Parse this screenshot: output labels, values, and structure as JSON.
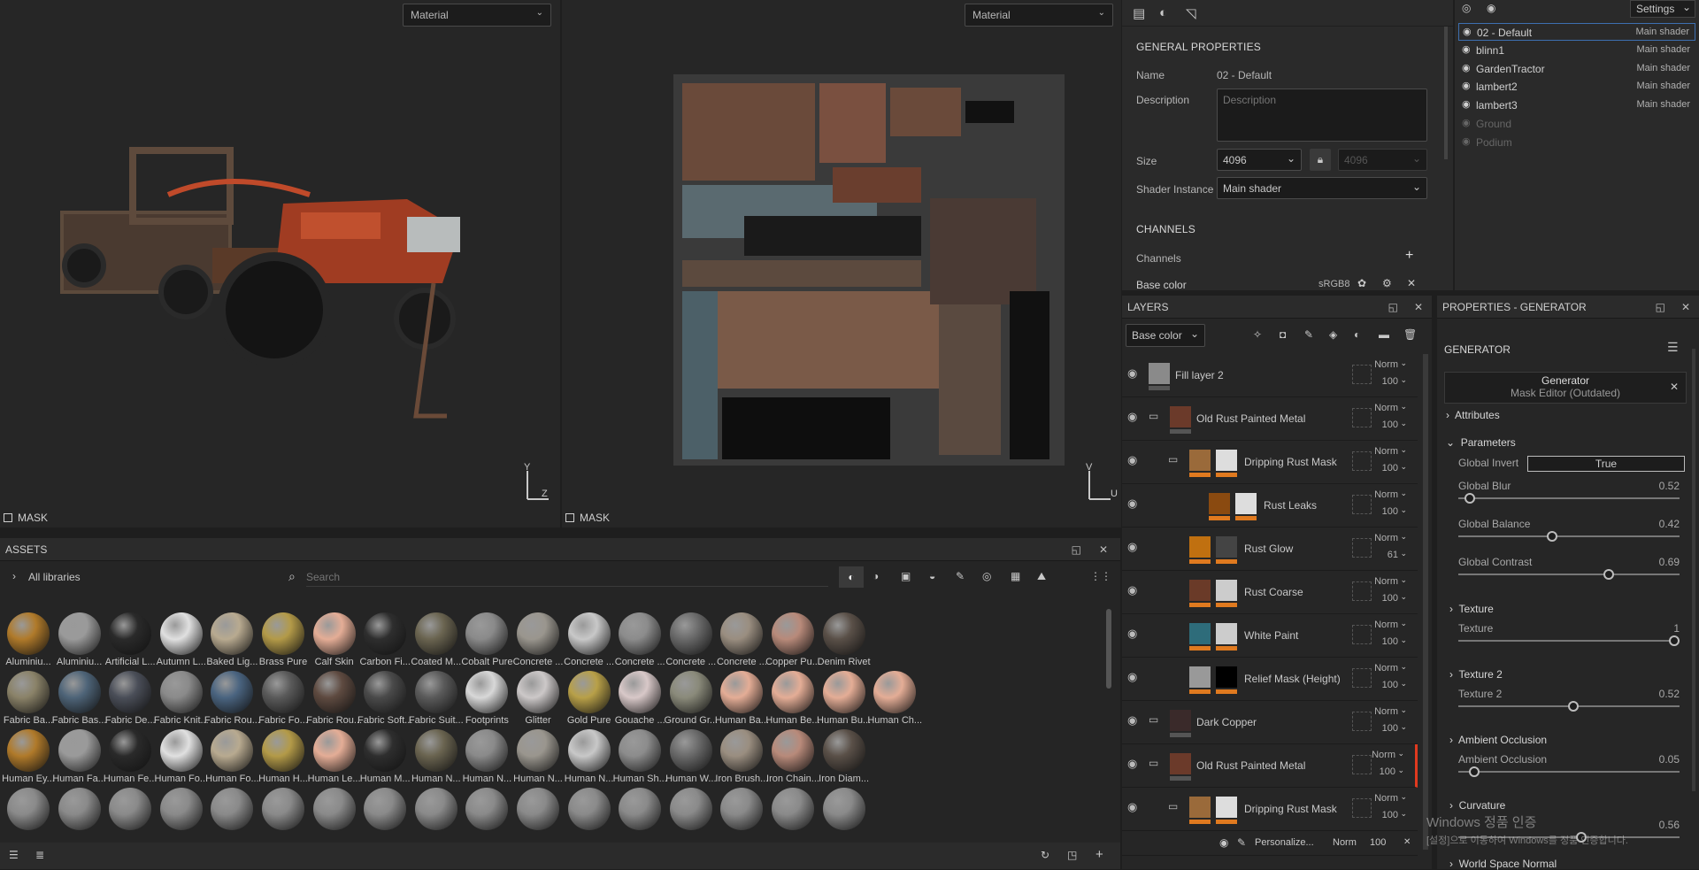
{
  "viewport3d": {
    "dropdown": "Material",
    "mask_label": "MASK"
  },
  "viewport2d": {
    "dropdown": "Material",
    "mask_label": "MASK"
  },
  "axis": {
    "y": "Y",
    "z": "Z",
    "v": "V",
    "u": "U"
  },
  "assets": {
    "title": "ASSETS",
    "library": "All libraries",
    "search_placeholder": "Search",
    "rows": [
      [
        "Aluminiu...",
        "Aluminiu...",
        "Artificial L...",
        "Autumn L...",
        "Baked Lig...",
        "Brass Pure",
        "Calf Skin",
        "Carbon Fi...",
        "Coated M...",
        "Cobalt Pure",
        "Concrete ...",
        "Concrete ...",
        "Concrete ...",
        "Concrete ...",
        "Concrete ...",
        "Copper Pu...",
        "Denim Rivet"
      ],
      [
        "Fabric Ba...",
        "Fabric Bas...",
        "Fabric De...",
        "Fabric Knit...",
        "Fabric Rou...",
        "Fabric Fo...",
        "Fabric Rou...",
        "Fabric Soft...",
        "Fabric Suit...",
        "Footprints",
        "Glitter",
        "Gold Pure",
        "Gouache ...",
        "Ground Gr...",
        "Human Ba...",
        "Human Be...",
        "Human Bu...",
        "Human Ch..."
      ],
      [
        "Human Ey...",
        "Human Fa...",
        "Human Fe...",
        "Human Fo...",
        "Human Fo...",
        "Human H...",
        "Human Le...",
        "Human M...",
        "Human N...",
        "Human N...",
        "Human N...",
        "Human N...",
        "Human Sh...",
        "Human W...",
        "Iron Brush...",
        "Iron Chain...",
        "Iron Diam..."
      ]
    ]
  },
  "properties_top": {
    "general_title": "GENERAL PROPERTIES",
    "name_label": "Name",
    "name_value": "02 - Default",
    "description_label": "Description",
    "description_placeholder": "Description",
    "size_label": "Size",
    "size_value": "4096",
    "size_value2": "4096",
    "shader_label": "Shader Instance",
    "shader_value": "Main shader",
    "channels_title": "CHANNELS",
    "channels_label": "Channels",
    "base_color_label": "Base color",
    "base_color_space": "sRGB8"
  },
  "texture_sets": {
    "settings": "Settings",
    "items": [
      {
        "name": "02 - Default",
        "shader": "Main shader",
        "active": true,
        "enabled": true
      },
      {
        "name": "blinn1",
        "shader": "Main shader",
        "active": false,
        "enabled": true
      },
      {
        "name": "GardenTractor",
        "shader": "Main shader",
        "active": false,
        "enabled": true
      },
      {
        "name": "lambert2",
        "shader": "Main shader",
        "active": false,
        "enabled": true
      },
      {
        "name": "lambert3",
        "shader": "Main shader",
        "active": false,
        "enabled": true
      },
      {
        "name": "Ground",
        "shader": "",
        "active": false,
        "enabled": false
      },
      {
        "name": "Podium",
        "shader": "",
        "active": false,
        "enabled": false
      }
    ]
  },
  "layers": {
    "title": "LAYERS",
    "channel": "Base color",
    "items": [
      {
        "name": "Fill layer 2",
        "blend": "Norm",
        "opacity": "100",
        "indent": 0,
        "folder": false,
        "thumb": "#8a8a8a",
        "mask": null
      },
      {
        "name": "Old Rust Painted Metal",
        "blend": "Norm",
        "opacity": "100",
        "indent": 0,
        "folder": true,
        "thumb": "#6b3a2a",
        "mask": null
      },
      {
        "name": "Dripping Rust Mask",
        "blend": "Norm",
        "opacity": "100",
        "indent": 1,
        "folder": true,
        "thumb": "#9a6a3a",
        "mask": "#ddd"
      },
      {
        "name": "Rust Leaks",
        "blend": "Norm",
        "opacity": "100",
        "indent": 2,
        "folder": false,
        "thumb": "#8a4a10",
        "mask": "#ddd"
      },
      {
        "name": "Rust Glow",
        "blend": "Norm",
        "opacity": "61",
        "indent": 1,
        "folder": false,
        "thumb": "#c07010",
        "mask": "#444"
      },
      {
        "name": "Rust Coarse",
        "blend": "Norm",
        "opacity": "100",
        "indent": 1,
        "folder": false,
        "thumb": "#6a3a28",
        "mask": "#ccc"
      },
      {
        "name": "White Paint",
        "blend": "Norm",
        "opacity": "100",
        "indent": 1,
        "folder": false,
        "thumb": "#2e6c7a",
        "mask": "#ccc"
      },
      {
        "name": "Relief Mask (Height)",
        "blend": "Norm",
        "opacity": "100",
        "indent": 1,
        "folder": false,
        "thumb": "#999",
        "mask": "#000"
      },
      {
        "name": "Dark Copper",
        "blend": "Norm",
        "opacity": "100",
        "indent": 0,
        "folder": true,
        "thumb": "#3a2a2a",
        "mask": null
      },
      {
        "name": "Old Rust Painted Metal",
        "blend": "Norm",
        "opacity": "100",
        "indent": 0,
        "folder": true,
        "thumb": "#6b3a2a",
        "mask": null
      },
      {
        "name": "Dripping Rust Mask",
        "blend": "Norm",
        "opacity": "100",
        "indent": 1,
        "folder": true,
        "thumb": "#9a6a3a",
        "mask": "#ddd"
      }
    ],
    "sub_row": {
      "name": "Personalize...",
      "blend": "Norm",
      "opacity": "100"
    }
  },
  "generator": {
    "title": "PROPERTIES - GENERATOR",
    "section": "GENERATOR",
    "card_title": "Generator",
    "card_subtitle": "Mask Editor (Outdated)",
    "attributes": "Attributes",
    "parameters": "Parameters",
    "global_invert_label": "Global Invert",
    "global_invert_value": "True",
    "params": [
      {
        "label": "Global Blur",
        "value": "0.52",
        "fraction": 0.03
      },
      {
        "label": "Global Balance",
        "value": "0.42",
        "fraction": 0.42
      },
      {
        "label": "Global Contrast",
        "value": "0.69",
        "fraction": 0.69
      }
    ],
    "groups": [
      {
        "title": "Texture",
        "label": "Texture",
        "value": "1",
        "fraction": 1.0
      },
      {
        "title": "Texture 2",
        "label": "Texture 2",
        "value": "0.52",
        "fraction": 0.52
      },
      {
        "title": "Ambient Occlusion",
        "label": "Ambient Occlusion",
        "value": "0.05",
        "fraction": 0.05
      },
      {
        "title": "Curvature",
        "label": "",
        "value": "0.56",
        "fraction": 0.56
      }
    ],
    "world_space_normal": "World Space Normal"
  },
  "watermark": {
    "line1": "Windows 정품 인증",
    "line2": "[설정]으로 이동하여 Windows를 정품 인증합니다."
  },
  "colors": {
    "accent": "#e07a1f",
    "panel": "#252525",
    "header": "#2b2b2b",
    "selection": "#3d6fb0"
  }
}
